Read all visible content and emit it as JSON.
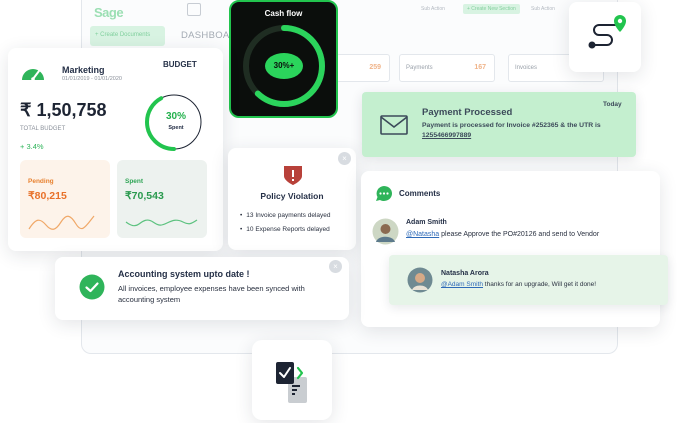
{
  "background": {
    "logo": "Sage",
    "create_button": "+ Create Documents",
    "dashboard_title": "DASHBOARD",
    "top_items": [
      "Sub Action",
      "+ Create New Section",
      "Sub Action"
    ],
    "tiles": [
      {
        "label": "",
        "value": "259"
      },
      {
        "label": "Payments",
        "value": "167"
      },
      {
        "label": "Invoices",
        "value": ""
      }
    ]
  },
  "cash_flow": {
    "title": "Cash flow",
    "percent_label": "30%+",
    "percent": 0.3
  },
  "marketing": {
    "title": "Marketing",
    "date_range": "01/01/2019 - 01/01/2020",
    "budget_label": "BUDGET",
    "total_amount": "₹ 1,50,758",
    "total_label": "TOTAL BUDGET",
    "change": "+ 3.4%",
    "spent_percent": 0.3,
    "spent_percent_label": "30%",
    "spent_label": "Spent",
    "pending": {
      "label": "Pending",
      "value": "₹80,215"
    },
    "spent": {
      "label": "Spent",
      "value": "₹70,543"
    }
  },
  "policy": {
    "title": "Policy Violation",
    "items": [
      "13 Invoice payments delayed",
      "10 Expense Reports delayed"
    ],
    "close": "×"
  },
  "payment": {
    "title": "Payment Processed",
    "body_prefix": "Payment is processed for Invoice #252365 & the UTR is ",
    "utr": "1255466997889",
    "time": "Today"
  },
  "comments": {
    "title": "Comments",
    "first": {
      "author": "Adam Smith",
      "mention": "@Natasha",
      "text": " please Approve the PO#20126 and send to Vendor"
    },
    "reply": {
      "author": "Natasha Arora",
      "mention": "@Adam Smith",
      "text": " thanks for an upgrade, Will get it done!"
    }
  },
  "accounting": {
    "title": "Accounting system upto date !",
    "body": "All invoices, employee expenses have been synced with accounting system",
    "close": "×"
  },
  "colors": {
    "accent": "#22c44e",
    "success_bg": "#c4efcf",
    "alert": "#c0392b",
    "pending": "#f07b2c"
  }
}
